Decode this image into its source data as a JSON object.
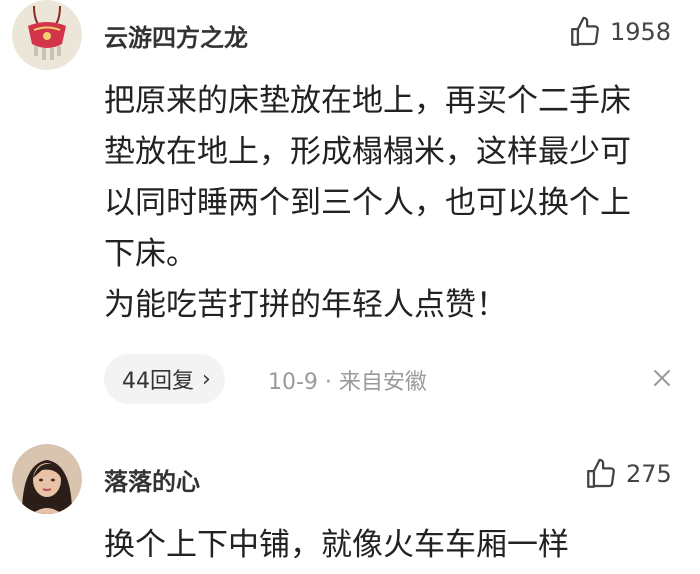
{
  "comments": [
    {
      "username": "云游四方之龙",
      "likes": "1958",
      "avatar_icon": "red-embroidered-pendant-avatar",
      "body_lines": [
        "把原来的床垫放在地上，再买个二手床",
        "垫放在地上，形成榻榻米，这样最少可",
        "以同时睡两个到三个人，也可以换个上",
        "下床。",
        "为能吃苦打拼的年轻人点赞！"
      ],
      "replies": "44回复",
      "meta": "10-9 · 来自安徽"
    },
    {
      "username": "落落的心",
      "likes": "275",
      "avatar_icon": "woman-portrait-avatar",
      "body_lines": [
        "换个上下中铺，就像火车车厢一样"
      ]
    }
  ],
  "colors": {
    "text": "#222222",
    "meta": "#9a9a9a",
    "pill_bg": "#f3f3f3"
  }
}
